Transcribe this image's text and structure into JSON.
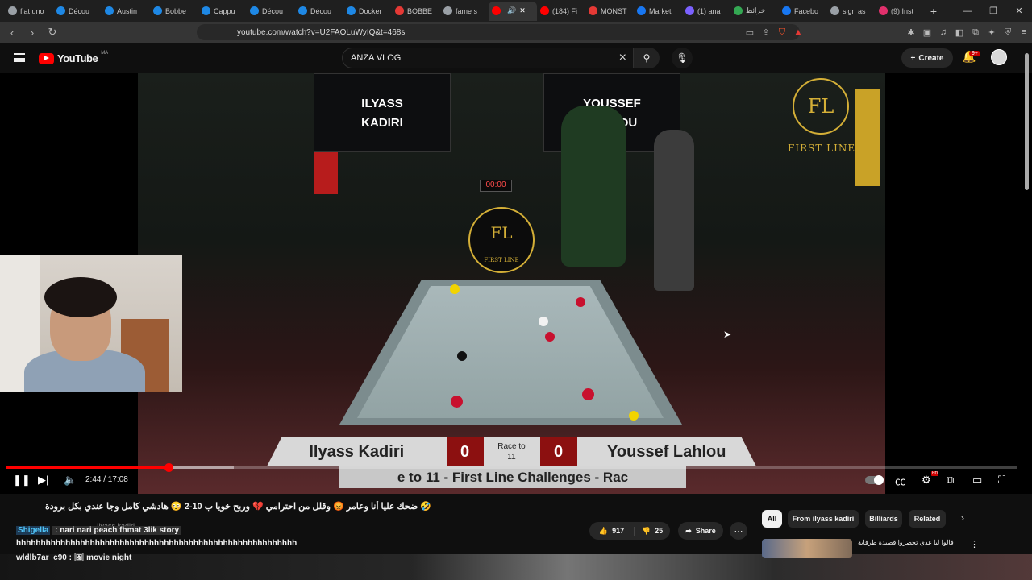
{
  "browser": {
    "tabs": [
      {
        "label": "fiat uno",
        "color": "#9aa0a6",
        "active": false
      },
      {
        "label": "Décou",
        "color": "#1e88e5",
        "active": false
      },
      {
        "label": "Austin",
        "color": "#1e88e5",
        "active": false
      },
      {
        "label": "Bobbe",
        "color": "#1e88e5",
        "active": false
      },
      {
        "label": "Cappu",
        "color": "#1e88e5",
        "active": false
      },
      {
        "label": "Décou",
        "color": "#1e88e5",
        "active": false
      },
      {
        "label": "Décou",
        "color": "#1e88e5",
        "active": false
      },
      {
        "label": "Docker",
        "color": "#1e88e5",
        "active": false
      },
      {
        "label": "BOBBE",
        "color": "#e53935",
        "active": false
      },
      {
        "label": "fame s",
        "color": "#9aa0a6",
        "active": false
      },
      {
        "label": "",
        "color": "#ff0000",
        "active": true
      },
      {
        "label": "(184) Fi",
        "color": "#ff0000",
        "active": false
      },
      {
        "label": "MONST",
        "color": "#e53935",
        "active": false
      },
      {
        "label": "Market",
        "color": "#1877f2",
        "active": false
      },
      {
        "label": "(1) ana",
        "color": "#7b61ff",
        "active": false
      },
      {
        "label": "خرائط",
        "color": "#34a853",
        "active": false
      },
      {
        "label": "Facebo",
        "color": "#1877f2",
        "active": false
      },
      {
        "label": "sign as",
        "color": "#9aa0a6",
        "active": false
      },
      {
        "label": "(9) Inst",
        "color": "#e1306c",
        "active": false
      }
    ],
    "url": "youtube.com/watch?v=U2FAOLuWyIQ&t=468s"
  },
  "header": {
    "logo_text": "YouTube",
    "logo_country": "MA",
    "search_query": "ANZA VLOG",
    "create_label": "Create",
    "notif_badge": "9+"
  },
  "video": {
    "banner_left": [
      "ILYASS",
      "KADIRI"
    ],
    "banner_right": [
      "YOUSSEF",
      "LAHLOU"
    ],
    "brand_name": "FIRST LINE",
    "brand_initials": "FL",
    "clock": "00:00",
    "score": {
      "player1": "Ilyass Kadiri",
      "score1": "0",
      "race_label": "Race to",
      "race_value": "11",
      "score2": "0",
      "player2": "Youssef Lahlou"
    },
    "ticker": "e to 11 - First Line Challenges - Rac",
    "progress": {
      "played_fraction": 0.16,
      "buffered_fraction": 0.225
    },
    "time": "2:44 / 17:08"
  },
  "below": {
    "title": "🤣 ضحك عليا أنا وعامر 😡 وقلل من احترامي 💔 وربح خويا ب 10-2 😳 هادشي كامل وجا عندي بكل برودة",
    "channel_name": "Ilyass kadiri",
    "chat": [
      {
        "user": "Shigella",
        "text": ": nari nari peach fhmat 3lik story",
        "user_color": "#4fc3f7"
      },
      {
        "user": "",
        "text": "hhhhhhhhhhhhhhhhhhhhhhhhhhhhhhhhhhhhhhhhhhhhhhhhhhhhhhhhh",
        "user_color": "#ffffff"
      },
      {
        "user": "wldlb7ar_c90",
        "text": ": 🖼 movie night",
        "user_color": "#ffffff"
      }
    ],
    "likes": "917",
    "dislikes": "25",
    "share_label": "Share",
    "chips": [
      "All",
      "From ilyass kadiri",
      "Billiards",
      "Related"
    ],
    "rec_title": "قالوا ليا عدي تحصروا قصيدة طرفاية"
  }
}
